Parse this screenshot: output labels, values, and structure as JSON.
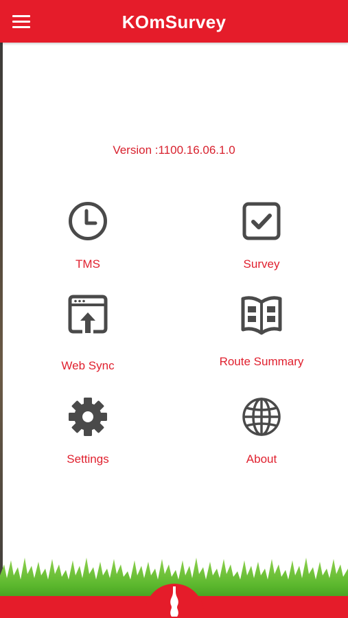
{
  "app": {
    "title": "KOmSurvey"
  },
  "version_text": "Version :1100.16.06.1.0",
  "menu": [
    {
      "label": "TMS",
      "icon": "clock-icon"
    },
    {
      "label": "Survey",
      "icon": "checkbox-icon"
    },
    {
      "label": "Web Sync",
      "icon": "upload-window-icon"
    },
    {
      "label": "Route Summary",
      "icon": "book-icon"
    },
    {
      "label": "Settings",
      "icon": "gear-icon"
    },
    {
      "label": "About",
      "icon": "globe-icon"
    }
  ],
  "colors": {
    "brand_red": "#e51c2a",
    "icon_gray": "#4a4a4a",
    "grass_green": "#5cb82e"
  },
  "footer_icon": "bottle-icon"
}
